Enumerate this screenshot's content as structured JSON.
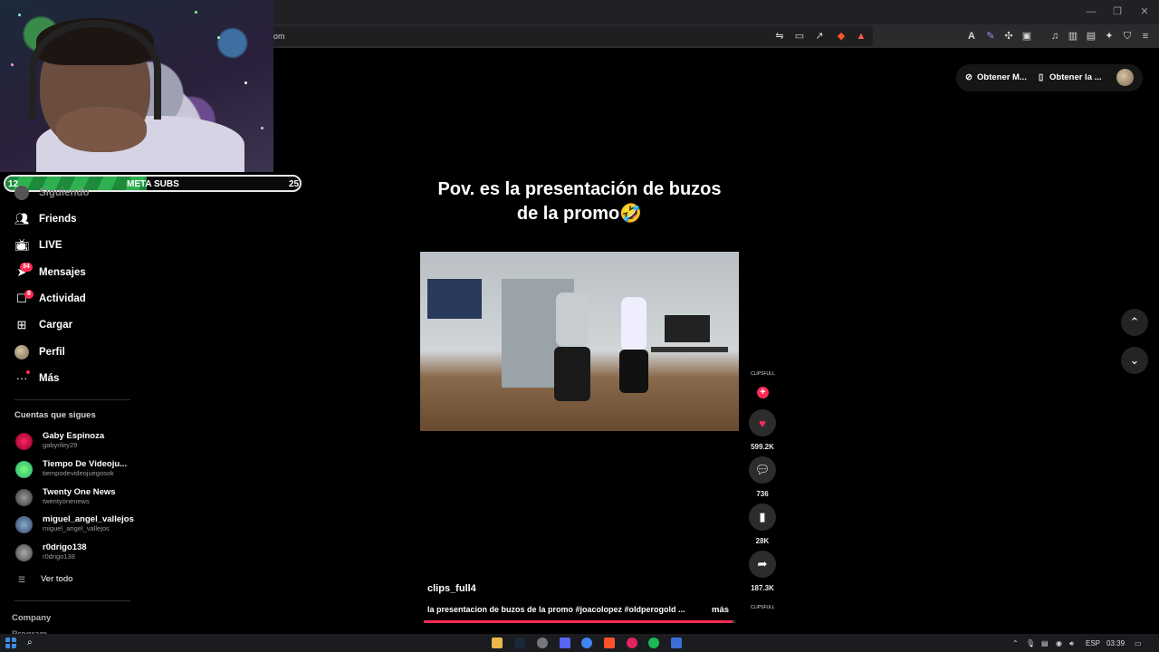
{
  "browser": {
    "url_fragment": "om",
    "window_controls": [
      "minimize",
      "restore",
      "close"
    ]
  },
  "overlay": {
    "subs_goal": {
      "label": "META SUBS",
      "current": "12",
      "goal": "25",
      "progress": 0.48
    }
  },
  "sidebar": {
    "nav": [
      {
        "label": "Siguiendo",
        "icon": "following-icon"
      },
      {
        "label": "Friends",
        "icon": "friends-icon"
      },
      {
        "label": "LIVE",
        "icon": "live-icon"
      },
      {
        "label": "Mensajes",
        "icon": "messages-icon",
        "badge": "34"
      },
      {
        "label": "Actividad",
        "icon": "activity-icon",
        "badge": "8"
      },
      {
        "label": "Cargar",
        "icon": "upload-icon"
      },
      {
        "label": "Perfil",
        "icon": "profile-avatar"
      },
      {
        "label": "Más",
        "icon": "more-icon"
      }
    ],
    "following_title": "Cuentas que sigues",
    "accounts": [
      {
        "name": "Gaby Espinoza",
        "username": "gabyriley29"
      },
      {
        "name": "Tiempo De Videoju...",
        "username": "tiempodevideojuegosok"
      },
      {
        "name": "Twenty One News",
        "username": "twentyonenews"
      },
      {
        "name": "miguel_angel_vallejos",
        "username": "miguel_angel_vallejos"
      },
      {
        "name": "r0drigo138",
        "username": "r0drigo138"
      }
    ],
    "see_all": "Ver todo",
    "footer": [
      "Company",
      "Program"
    ]
  },
  "header": {
    "get_app_1": "Obtener M...",
    "get_app_2": "Obtener la ..."
  },
  "video": {
    "caption_line1": "Pov. es la presentación de buzos",
    "caption_line2": "de la promo🤣",
    "author": "clips_full4",
    "description": "la presentacion de buzos de la promo #joacolopez #oldperogold ...",
    "more": "más",
    "progress": 0.99,
    "channel_mini": "CLIPSFULL",
    "likes": "599.2K",
    "comments": "736",
    "saves": "28K",
    "shares": "187.3K"
  },
  "taskbar": {
    "language": "ESP",
    "time": "03:39"
  },
  "colors": {
    "accent": "#fe2c55",
    "subs_fill": "#2fb150"
  }
}
